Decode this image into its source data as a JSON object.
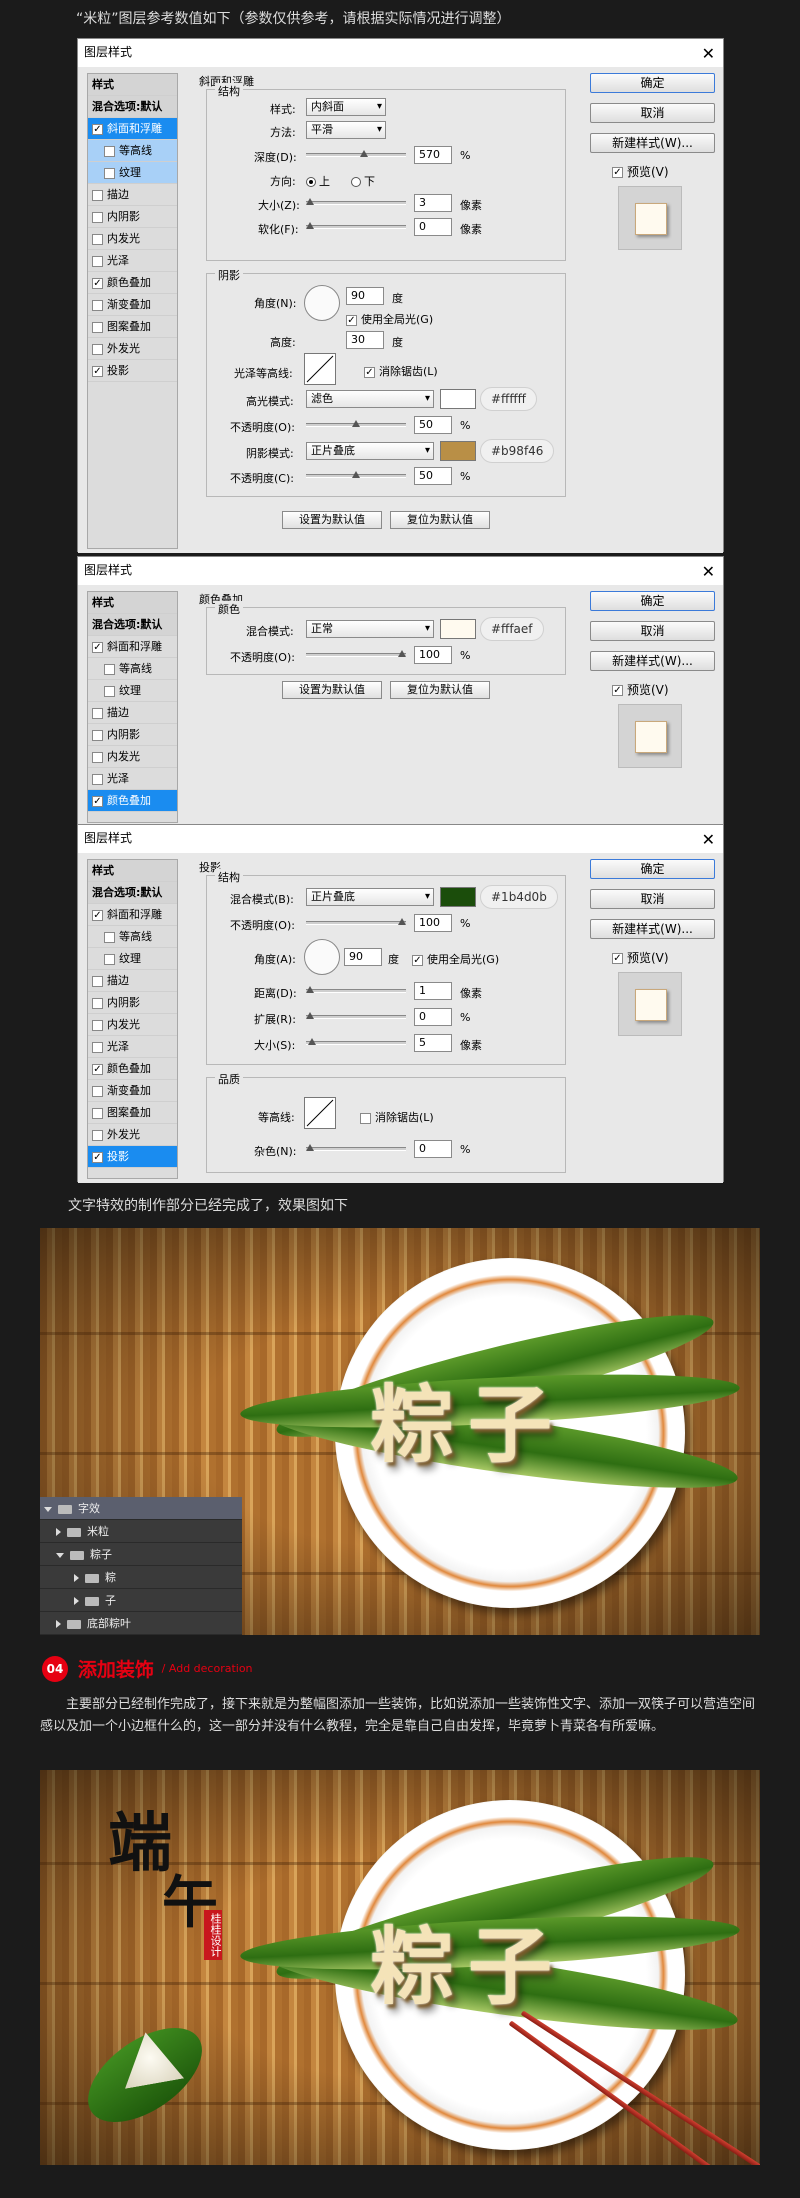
{
  "intro": "“米粒”图层参考数值如下（参数仅供参考，请根据实际情况进行调整）",
  "dialog_title": "图层样式",
  "close_glyph": "✕",
  "styles_list": {
    "head": "样式",
    "blend": "混合选项:默认",
    "bevel": "斜面和浮雕",
    "contour": "等高线",
    "texture": "纹理",
    "stroke": "描边",
    "inner_shadow": "内阴影",
    "inner_glow": "内发光",
    "satin": "光泽",
    "color_overlay": "颜色叠加",
    "gradient_overlay": "渐变叠加",
    "pattern_overlay": "图案叠加",
    "outer_glow": "外发光",
    "drop_shadow": "投影"
  },
  "right_panel": {
    "ok": "确定",
    "cancel": "取消",
    "new_style": "新建样式(W)...",
    "preview": "预览(V)"
  },
  "check_glyph": "✓",
  "bevel": {
    "section": "斜面和浮雕",
    "structure": "结构",
    "style_label": "样式:",
    "style_value": "内斜面",
    "technique_label": "方法:",
    "technique_value": "平滑",
    "depth_label": "深度(D):",
    "depth_value": "570",
    "percent": "%",
    "direction_label": "方向:",
    "dir_up": "上",
    "dir_down": "下",
    "size_label": "大小(Z):",
    "size_value": "3",
    "px": "像素",
    "soften_label": "软化(F):",
    "soften_value": "0",
    "shading": "阴影",
    "angle_label": "角度(N):",
    "angle_value": "90",
    "degree": "度",
    "global_light": "使用全局光(G)",
    "altitude_label": "高度:",
    "altitude_value": "30",
    "gloss_label": "光泽等高线:",
    "anti_alias": "消除锯齿(L)",
    "hl_mode_label": "高光模式:",
    "hl_mode_value": "滤色",
    "hl_hex": "#ffffff",
    "hl_color": "#ffffff",
    "hl_opacity_label": "不透明度(O):",
    "hl_opacity_value": "50",
    "sh_mode_label": "阴影模式:",
    "sh_mode_value": "正片叠底",
    "sh_hex": "#b98f46",
    "sh_color": "#b98f46",
    "sh_opacity_label": "不透明度(C):",
    "sh_opacity_value": "50",
    "make_default": "设置为默认值",
    "reset_default": "复位为默认值"
  },
  "overlay": {
    "section": "颜色叠加",
    "color_group": "颜色",
    "mode_label": "混合模式:",
    "mode_value": "正常",
    "hex": "#fffaef",
    "color": "#fffaef",
    "opacity_label": "不透明度(O):",
    "opacity_value": "100",
    "percent": "%",
    "make_default": "设置为默认值",
    "reset_default": "复位为默认值"
  },
  "shadow": {
    "section": "投影",
    "structure": "结构",
    "mode_label": "混合模式(B):",
    "mode_value": "正片叠底",
    "hex": "#1b4d0b",
    "color": "#1b4d0b",
    "opacity_label": "不透明度(O):",
    "opacity_value": "100",
    "percent": "%",
    "angle_label": "角度(A):",
    "angle_value": "90",
    "degree": "度",
    "global_light": "使用全局光(G)",
    "distance_label": "距离(D):",
    "distance_value": "1",
    "spread_label": "扩展(R):",
    "spread_value": "0",
    "size_label": "大小(S):",
    "size_value": "5",
    "px": "像素",
    "quality": "品质",
    "contour_label": "等高线:",
    "anti_alias": "消除锯齿(L)",
    "noise_label": "杂色(N):",
    "noise_value": "0"
  },
  "caption1": "文字特效的制作部分已经完成了，效果图如下",
  "art_text": "粽子",
  "layers": {
    "group_fx": "字效",
    "rice": "米粒",
    "zongzi": "粽子",
    "zong": "粽",
    "zi": "子",
    "bottom_leaf": "底部粽叶"
  },
  "section4": {
    "num": "04",
    "title": "添加装饰",
    "subtitle": "/ Add decoration",
    "text": "主要部分已经制作完成了，接下来就是为整幅图添加一些装饰，比如说添加一些装饰性文字、添加一双筷子可以营造空间感以及加一个小边框什么的，这一部分并没有什么教程，完全是靠自己自由发挥，毕竟萝卜青菜各有所爱嘛。"
  },
  "duanwu": {
    "duan": "端",
    "wu": "午",
    "seal": "桂桂设计"
  }
}
